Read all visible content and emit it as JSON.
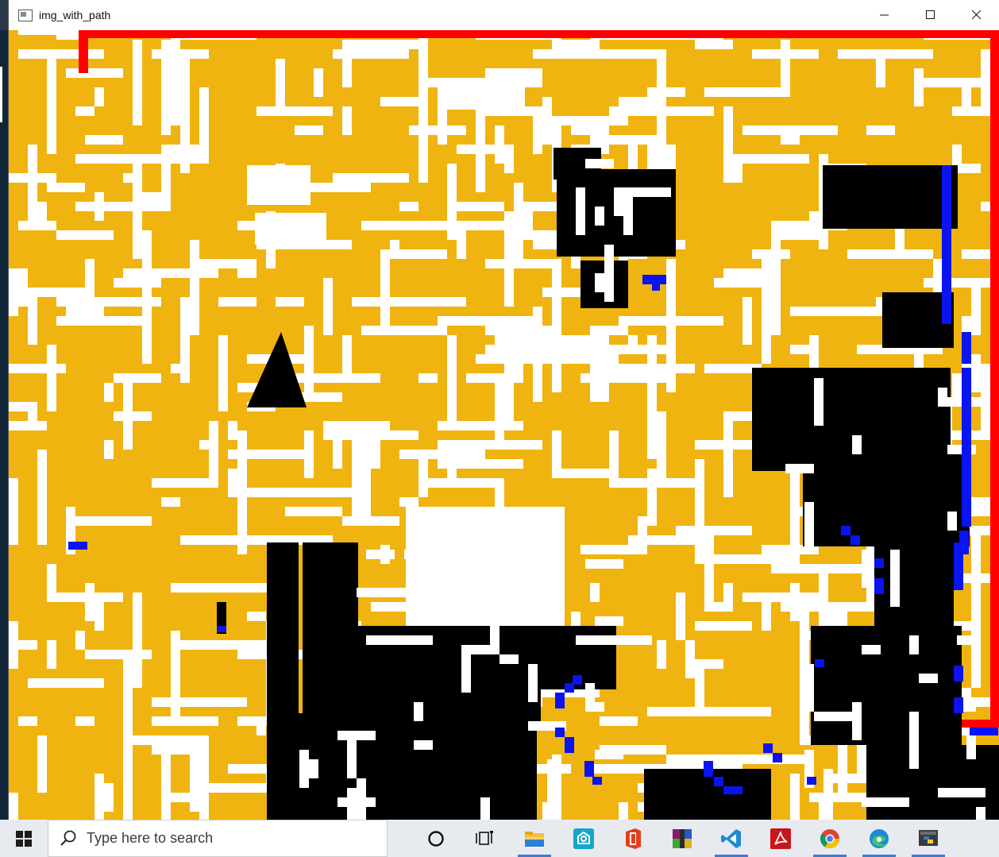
{
  "window": {
    "title": "img_with_path",
    "controls": {
      "minimize": "—",
      "maximize": "☐",
      "close": "✕"
    }
  },
  "maze": {
    "colors": {
      "wall": "#ffffff",
      "open": "#f0b410",
      "unexplored": "#000000",
      "frontier": "#0a14f0",
      "path": "#ff0000"
    }
  },
  "taskbar": {
    "search_placeholder": "Type here to search",
    "apps": [
      "cortana-icon",
      "task-view-icon",
      "file-explorer-icon",
      "app-store-icon",
      "office-icon",
      "winrar-icon",
      "vscode-icon",
      "acrobat-icon",
      "chrome-icon",
      "edge-icon",
      "python-icon"
    ]
  }
}
